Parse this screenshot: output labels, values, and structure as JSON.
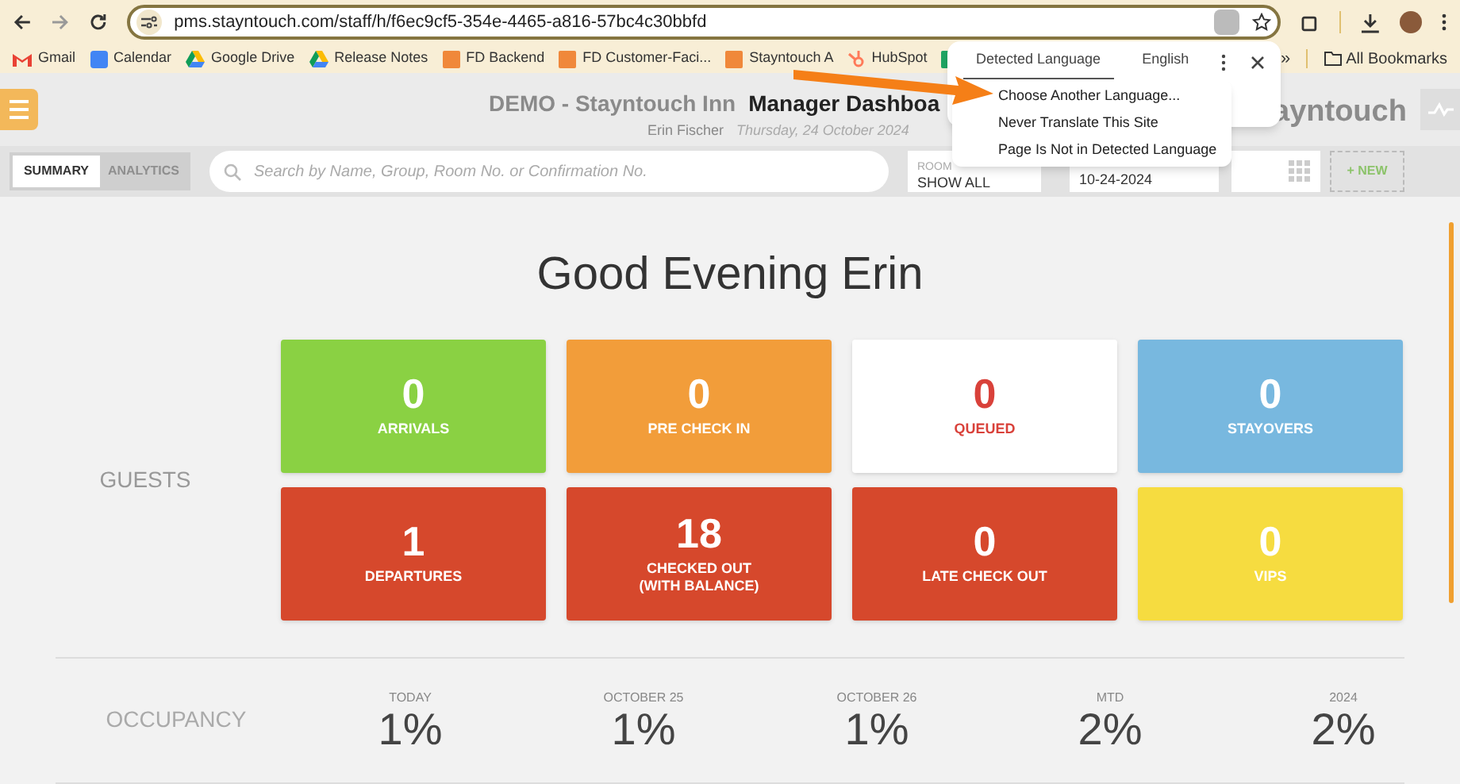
{
  "browser": {
    "url": "pms.stayntouch.com/staff/h/f6ec9cf5-354e-4465-a816-57bc4c30bbfd",
    "bookmarks": [
      {
        "label": "Gmail",
        "kind": "gmail"
      },
      {
        "label": "Calendar",
        "kind": "calendar"
      },
      {
        "label": "Google Drive",
        "kind": "drive"
      },
      {
        "label": "Release Notes",
        "kind": "drive"
      },
      {
        "label": "FD Backend",
        "kind": "site"
      },
      {
        "label": "FD Customer-Faci...",
        "kind": "site"
      },
      {
        "label": "Stayntouch A",
        "kind": "site"
      },
      {
        "label": "HubSpot",
        "kind": "hubspot"
      },
      {
        "kind": "sheet"
      }
    ],
    "more": "»",
    "all_bookmarks": "All Bookmarks"
  },
  "translate_popup": {
    "tabs": [
      {
        "label": "Detected Language",
        "selected": true
      },
      {
        "label": "English",
        "selected": false
      }
    ],
    "menu": [
      "Choose Another Language...",
      "Never Translate This Site",
      "Page Is Not in Detected Language"
    ]
  },
  "header": {
    "title": "DEMO - Stayntouch Inn",
    "page": "Manager Dashboa",
    "user": "Erin Fischer",
    "date": "Thursday, 24 October 2024",
    "logo": "ayntouch"
  },
  "toolbar": {
    "tabs": [
      {
        "label": "SUMMARY",
        "selected": true
      },
      {
        "label": "ANALYTICS",
        "selected": false
      }
    ],
    "search": {
      "placeholder": "Search by Name, Group, Room No. or Confirmation No."
    },
    "room_filter": {
      "label": "ROOM",
      "value": "SHOW ALL"
    },
    "date": "10-24-2024",
    "new_button": "+ NEW"
  },
  "greeting": "Good Evening Erin",
  "guests": {
    "label": "GUESTS",
    "tiles": [
      {
        "count": "0",
        "label": "ARRIVALS",
        "color": "#8ad143",
        "kind": "filled"
      },
      {
        "count": "0",
        "label": "PRE CHECK IN",
        "color": "#f29d3a",
        "kind": "filled"
      },
      {
        "count": "0",
        "label": "QUEUED",
        "color": "#d9413a",
        "kind": "light"
      },
      {
        "count": "0",
        "label": "STAYOVERS",
        "color": "#78b8df",
        "kind": "filled"
      },
      {
        "count": "1",
        "label": "DEPARTURES",
        "color": "#d6482c",
        "kind": "filled"
      },
      {
        "count": "18",
        "label": "CHECKED OUT\n(WITH BALANCE)",
        "color": "#d6482c",
        "kind": "filled"
      },
      {
        "count": "0",
        "label": "LATE CHECK OUT",
        "color": "#d6482c",
        "kind": "filled"
      },
      {
        "count": "0",
        "label": "VIPS",
        "color": "#f6dc40",
        "kind": "filled"
      }
    ]
  },
  "occupancy": {
    "label": "OCCUPANCY",
    "columns": [
      {
        "period": "TODAY",
        "value": "1%"
      },
      {
        "period": "OCTOBER 25",
        "value": "1%"
      },
      {
        "period": "OCTOBER 26",
        "value": "1%"
      },
      {
        "period": "MTD",
        "value": "2%"
      },
      {
        "period": "2024",
        "value": "2%"
      }
    ]
  }
}
